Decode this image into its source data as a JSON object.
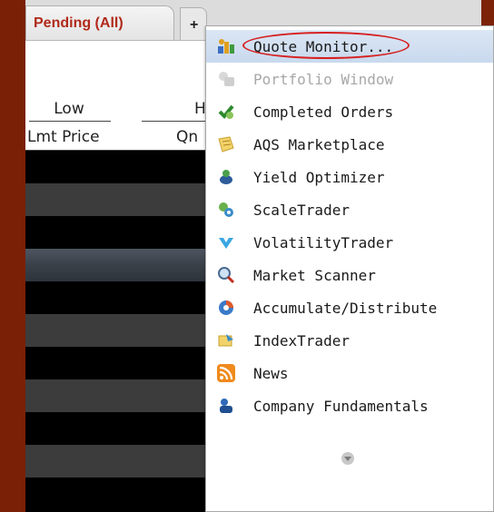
{
  "tabs": {
    "active_label": "Pending (All)",
    "add_label": "+"
  },
  "table": {
    "header_top": [
      "Low",
      "H"
    ],
    "header_bottom": [
      "Lmt Price",
      "Qn"
    ]
  },
  "menu": {
    "items": [
      {
        "label": "Quote Monitor...",
        "icon": "quote-monitor-icon",
        "state": "highlighted"
      },
      {
        "label": "Portfolio Window",
        "icon": "portfolio-icon",
        "state": "disabled"
      },
      {
        "label": "Completed Orders",
        "icon": "completed-orders-icon",
        "state": "normal"
      },
      {
        "label": "AQS Marketplace",
        "icon": "aqs-icon",
        "state": "normal"
      },
      {
        "label": "Yield Optimizer",
        "icon": "yield-icon",
        "state": "normal"
      },
      {
        "label": "ScaleTrader",
        "icon": "scaletrader-icon",
        "state": "normal"
      },
      {
        "label": "VolatilityTrader",
        "icon": "volatility-icon",
        "state": "normal"
      },
      {
        "label": "Market Scanner",
        "icon": "scanner-icon",
        "state": "normal"
      },
      {
        "label": "Accumulate/Distribute",
        "icon": "accumulate-icon",
        "state": "normal"
      },
      {
        "label": "IndexTrader",
        "icon": "indextrader-icon",
        "state": "normal"
      },
      {
        "label": "News",
        "icon": "rss-icon",
        "state": "normal"
      },
      {
        "label": "Company Fundamentals",
        "icon": "fundamentals-icon",
        "state": "normal"
      }
    ],
    "scroll_icon": "scroll-down-icon"
  },
  "colors": {
    "tab_text": "#b02a1a",
    "highlight_bg": "#c9d9ee",
    "annotation_circle": "#d62020"
  }
}
